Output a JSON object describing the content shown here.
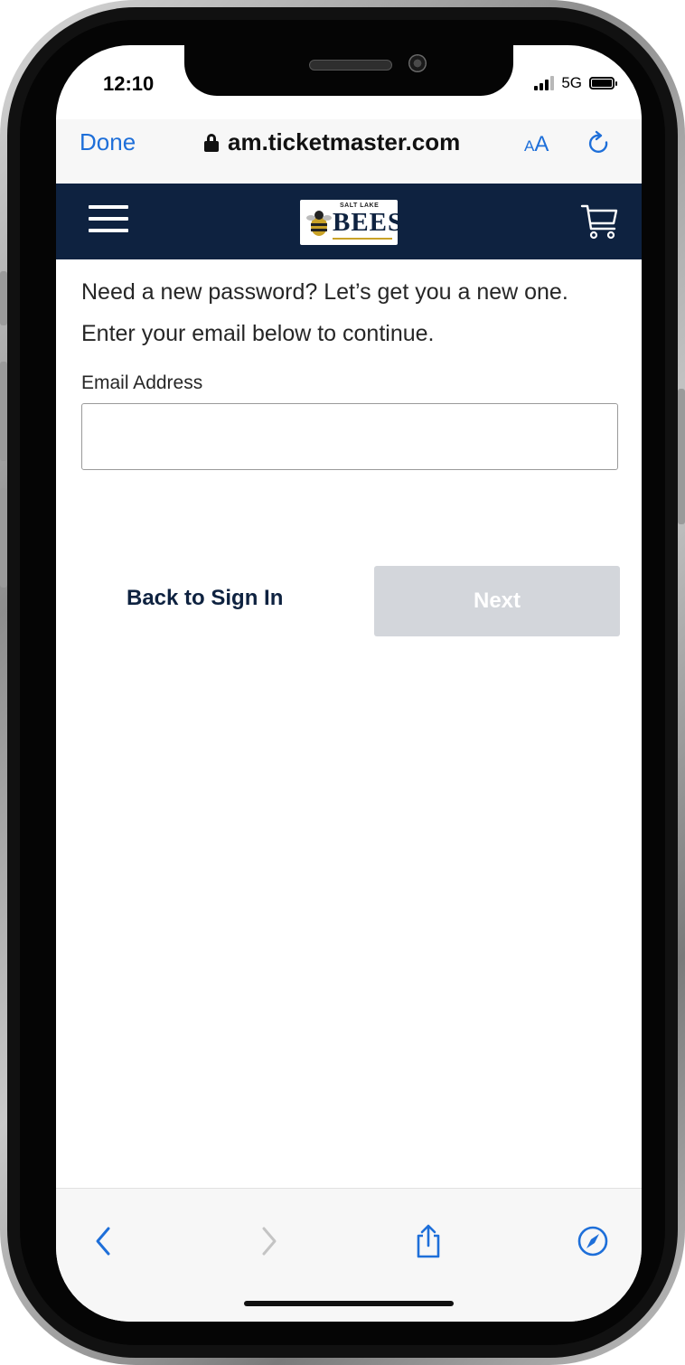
{
  "status_bar": {
    "time": "12:10",
    "network": "5G"
  },
  "browser": {
    "done_label": "Done",
    "url": "am.ticketmaster.com",
    "text_size_small": "A",
    "text_size_large": "A"
  },
  "site": {
    "logo_top_text": "SALT LAKE",
    "logo_text": "BEES"
  },
  "form": {
    "intro": "Need a new password? Let’s get you a new one. Enter your email below to continue.",
    "email_label": "Email Address",
    "email_value": "",
    "email_placeholder": "",
    "back_label": "Back to Sign In",
    "next_label": "Next"
  },
  "colors": {
    "header_navy": "#0e2240",
    "link_blue": "#1e6fd9",
    "next_disabled_bg": "#d3d6db"
  },
  "icons": {
    "browser": [
      "lock-icon",
      "text-size-icon",
      "reload-icon"
    ],
    "header": [
      "menu-icon",
      "cart-icon"
    ],
    "toolbar": [
      "back-icon",
      "forward-icon",
      "share-icon",
      "compass-icon"
    ]
  }
}
